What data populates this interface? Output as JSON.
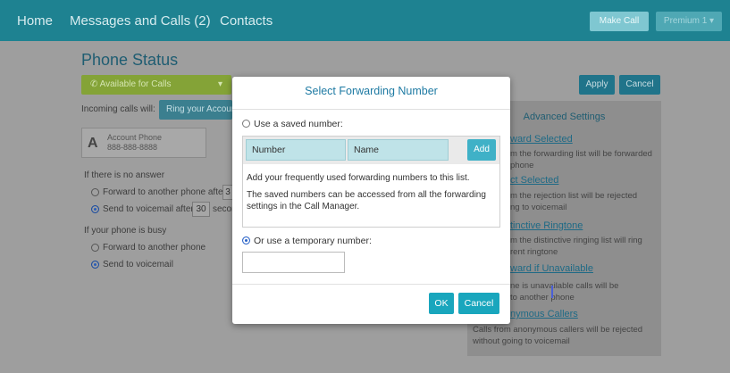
{
  "topbar": {
    "home": "Home",
    "messages": "Messages and Calls (2)",
    "contacts": "Contacts",
    "make_call": "Make Call",
    "premium": "Premium 1 ▾"
  },
  "page": {
    "title": "Phone Status",
    "status_value": "Available for Calls",
    "incoming_label": "Incoming calls will:",
    "ring_button": "Ring your Account Phone",
    "account_letter": "A",
    "account_name": "Account Phone",
    "account_number": "888-888-8888",
    "no_answer_label": "If there is no answer",
    "forward_after": "Forward to another phone after",
    "forward_after_num": "3",
    "voicemail_after": "Send to voicemail after",
    "voicemail_after_num": "30",
    "voicemail_after_unit": "seconds",
    "busy_label": "If your phone is busy",
    "busy_forward": "Forward to another phone",
    "busy_voicemail": "Send to voicemail",
    "apply": "Apply",
    "cancel": "Cancel"
  },
  "advanced": {
    "title": "Advanced Settings",
    "items": [
      {
        "heading": "ward Selected",
        "desc1": "m the forwarding list will be forwarded",
        "desc2": "phone"
      },
      {
        "heading": "ct Selected",
        "desc1": "m the rejection list will be rejected",
        "desc2": "ng to voicemail"
      },
      {
        "heading": "tinctive Ringtone",
        "desc1": "m the distinctive ringing list will ring",
        "desc2": "rent ringtone"
      },
      {
        "heading": "ward if Unavailable",
        "desc1": "ne is unavailable calls will be",
        "desc2": "to another phone"
      },
      {
        "heading": "nymous Callers",
        "desc1": "Calls from anonymous callers will be rejected",
        "desc2": "without going to voicemail"
      }
    ]
  },
  "modal": {
    "title": "Select Forwarding Number",
    "saved_option": "Use a saved number:",
    "number_placeholder": "Number",
    "name_placeholder": "Name",
    "add": "Add",
    "hint1": "Add your frequently used forwarding numbers to this list.",
    "hint2a": "The saved numbers can be accessed from all the forwarding",
    "hint2b": "settings in the Call Manager.",
    "temp_option": "Or use a temporary number:",
    "temp_value": "",
    "ok": "OK",
    "cancel": "Cancel",
    "saved_selected": false,
    "temp_selected": true
  }
}
